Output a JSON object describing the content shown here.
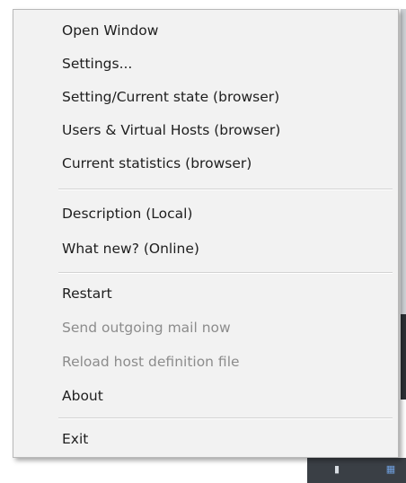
{
  "menu": {
    "items": [
      {
        "label": "Open Window",
        "enabled": true
      },
      {
        "label": "Settings...",
        "enabled": true
      },
      {
        "label": "Setting/Current state (browser)",
        "enabled": true
      },
      {
        "label": "Users & Virtual Hosts (browser)",
        "enabled": true
      },
      {
        "label": "Current statistics (browser)",
        "enabled": true
      },
      {
        "label": "Description (Local)",
        "enabled": true
      },
      {
        "label": "What new?  (Online)",
        "enabled": true
      },
      {
        "label": "Restart",
        "enabled": true
      },
      {
        "label": "Send outgoing mail now",
        "enabled": false
      },
      {
        "label": "Reload host definition file",
        "enabled": false
      },
      {
        "label": "About",
        "enabled": true
      },
      {
        "label": "Exit",
        "enabled": true
      }
    ]
  },
  "colors": {
    "menu_bg": "#f2f2f2",
    "text": "#1e1e1e",
    "disabled_text": "#8c8c8c",
    "separator": "#d3d3d3"
  },
  "tray": {
    "icons": [
      "tray-app-icon",
      "tray-network-icon"
    ]
  }
}
